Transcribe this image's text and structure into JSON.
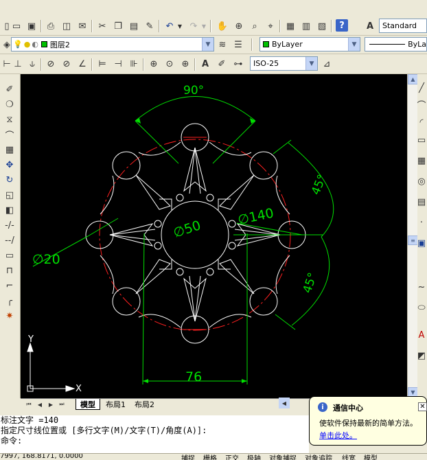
{
  "toolbar_row1": {
    "icons": [
      "new-icon",
      "open-icon",
      "save-icon",
      "print-icon",
      "preview-icon",
      "publish-icon",
      "cut-icon",
      "copy-icon",
      "paste-icon",
      "match-prop-icon",
      "undo-icon",
      "redo-icon",
      "pan-icon",
      "zoom-realtime-icon",
      "zoom-window-icon",
      "zoom-previous-icon",
      "properties-icon",
      "design-center-icon",
      "tool-palettes-icon",
      "help-icon"
    ],
    "text_style_value": "Standard"
  },
  "toolbar_row2": {
    "layer_value": "图层2",
    "color_value": "ByLayer",
    "linetype_value": "ByLa"
  },
  "toolbar_row3": {
    "dim_style_value": "ISO-25"
  },
  "drawing": {
    "dim_angle_top": "90°",
    "dim_angle_right_upper": "45°",
    "dim_angle_right_lower": "45°",
    "dim_diameter_center": "∅50",
    "dim_diameter_pitch": "∅140",
    "dim_diameter_hole": "∅20",
    "dim_linear_bottom": "76",
    "ucs_y": "Y",
    "ucs_x": "X",
    "colors": {
      "background": "#000000",
      "geometry": "#ffffff",
      "dimension": "#00e000",
      "centerline": "#ff2020"
    }
  },
  "tabs": {
    "model": "模型",
    "layout1": "布局1",
    "layout2": "布局2"
  },
  "command_line": {
    "line1": "标注文字 =140",
    "line2": "指定尺寸线位置或 [多行文字(M)/文字(T)/角度(A)]:",
    "line3": "命令:"
  },
  "balloon": {
    "title": "通信中心",
    "message": "使软件保持最新的简单方法。",
    "link": "单击此处。"
  },
  "status_bar": {
    "coordinates": "7997, 168.8171, 0.0000",
    "snap": "捕捉",
    "grid": "栅格",
    "ortho": "正交",
    "polar": "极轴",
    "osnap": "对象捕捉",
    "otrack": "对象追踪",
    "lwt": "线宽",
    "model": "模型"
  }
}
